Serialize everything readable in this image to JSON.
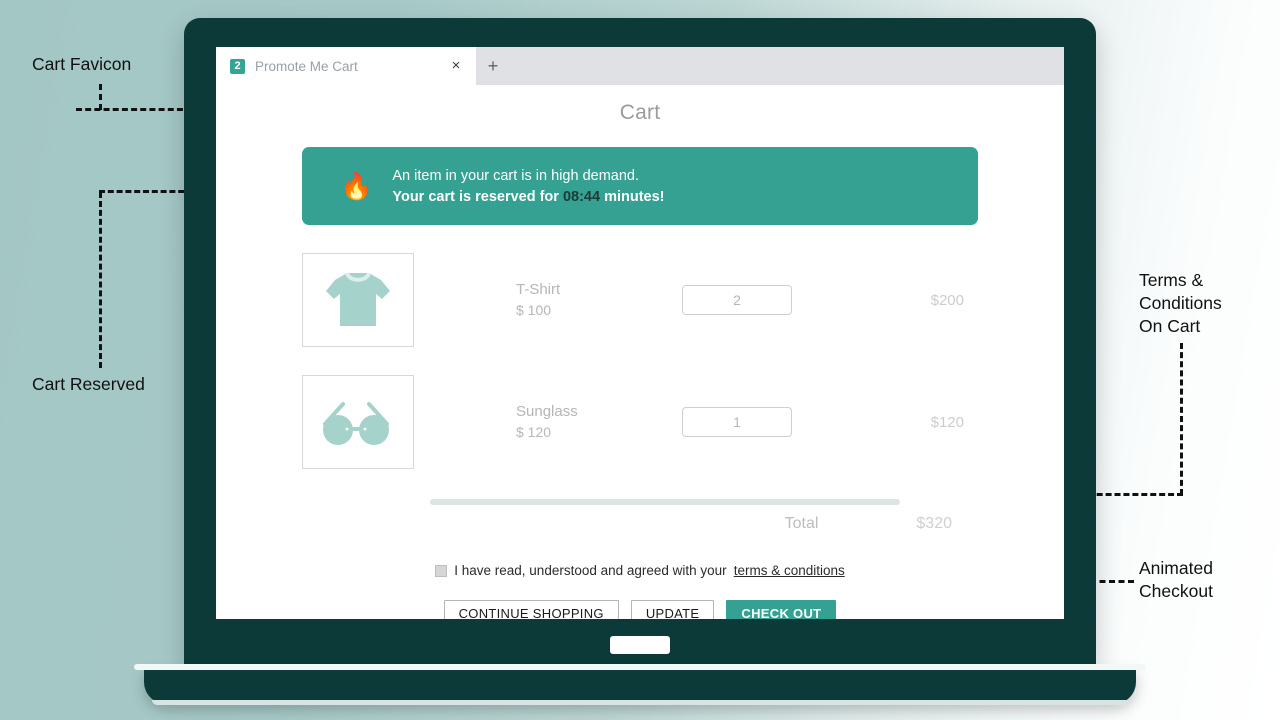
{
  "browser": {
    "favicon_badge": "2",
    "tab_title": "Promote Me Cart",
    "close_icon": "×",
    "new_tab_icon": "+"
  },
  "page": {
    "title": "Cart",
    "banner": {
      "icon": "🔥",
      "line1": "An item in your cart is in high demand.",
      "line2_prefix": "Your cart is reserved for ",
      "timer": "08:44",
      "line2_suffix": " minutes!",
      "bg_color": "#34a192"
    },
    "items": [
      {
        "image": "tshirt-image",
        "name": "T-Shirt",
        "price": "$ 100",
        "qty": "2",
        "line_total": "$200"
      },
      {
        "image": "sunglass-image",
        "name": "Sunglass",
        "price": "$ 120",
        "qty": "1",
        "line_total": "$120"
      }
    ],
    "total_label": "Total",
    "total_value": "$320",
    "terms": {
      "checked": false,
      "text": "I have read, understood and agreed with your ",
      "link": "terms & conditions"
    },
    "buttons": {
      "continue": "CONTINUE SHOPPING",
      "update": "UPDATE",
      "checkout": "CHECK OUT",
      "checkout_color": "#34a192"
    }
  },
  "annotations": {
    "cart_favicon": "Cart Favicon",
    "cart_reserved": "Cart Reserved",
    "terms_on_cart": "Terms &\nConditions\nOn Cart",
    "animated_checkout": "Animated\nCheckout"
  }
}
